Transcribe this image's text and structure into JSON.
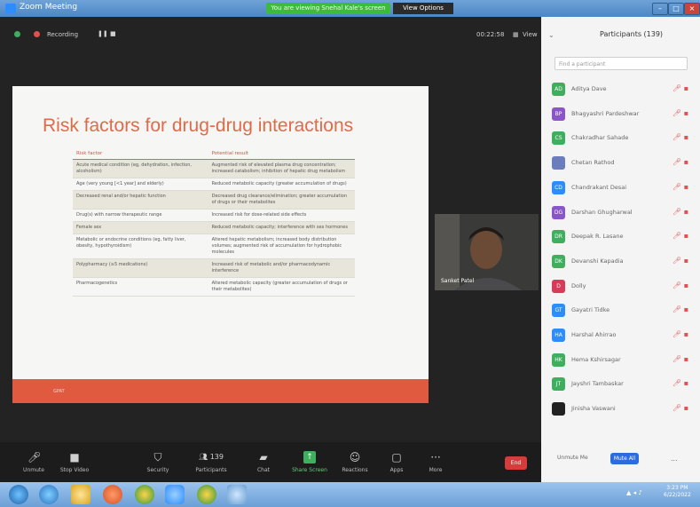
{
  "window": {
    "title": "Zoom Meeting",
    "share_banner": "You are viewing Snehal Kale's screen",
    "view_options": "View Options"
  },
  "topbar": {
    "recording": "Recording",
    "timer": "00:22:58",
    "view": "View"
  },
  "slide": {
    "title": "Risk factors for drug-drug interactions",
    "columns": [
      "Risk factor",
      "Potential result"
    ],
    "rows": [
      [
        "Acute medical condition (eg, dehydration, infection, alcoholism)",
        "Augmented risk of elevated plasma drug concentration; increased catabolism; inhibition of hepatic drug metabolism"
      ],
      [
        "Age (very young [<1 year] and elderly)",
        "Reduced metabolic capacity (greater accumulation of drugs)"
      ],
      [
        "Decreased renal and/or hepatic function",
        "Decreased drug clearance/elimination; greater accumulation of drugs or their metabolites"
      ],
      [
        "Drug(s) with narrow therapeutic range",
        "Increased risk for dose-related side effects"
      ],
      [
        "Female sex",
        "Reduced metabolic capacity; interference with sex hormones"
      ],
      [
        "Metabolic or endocrine conditions (eg, fatty liver, obesity, hypothyroidism)",
        "Altered hepatic metabolism; increased body distribution volumes; augmented risk of accumulation for hydrophobic molecules"
      ],
      [
        "Polypharmacy (≥5 medications)",
        "Increased risk of metabolic and/or pharmacodynamic interference"
      ],
      [
        "Pharmacogenetics",
        "Altered metabolic capacity (greater accumulation of drugs or their metabolites)"
      ]
    ],
    "footer": "GPAT"
  },
  "camera": {
    "name": "Sanket Patel"
  },
  "toolbar": {
    "unmute": "Unmute",
    "stop_video": "Stop Video",
    "security": "Security",
    "participants": "Participants",
    "participants_count": "139",
    "chat": "Chat",
    "share_screen": "Share Screen",
    "reactions": "Reactions",
    "apps": "Apps",
    "more": "More",
    "end": "End"
  },
  "panel": {
    "title": "Participants (139)",
    "search_placeholder": "Find a participant",
    "participants": [
      {
        "initials": "AD",
        "name": "Aditya Dave",
        "color": "#3fae5e"
      },
      {
        "initials": "BP",
        "name": "Bhagyashri Pardeshwar",
        "color": "#8a55c9"
      },
      {
        "initials": "CS",
        "name": "Chakradhar Sahade",
        "color": "#3fae5e"
      },
      {
        "initials": "",
        "name": "Chetan Rathod",
        "color": "#6a7dbd"
      },
      {
        "initials": "CD",
        "name": "Chandrakant Desai",
        "color": "#2d8cff"
      },
      {
        "initials": "DG",
        "name": "Darshan Ghugharwal",
        "color": "#8a55c9"
      },
      {
        "initials": "DR",
        "name": "Deepak R. Lasane",
        "color": "#3fae5e"
      },
      {
        "initials": "DK",
        "name": "Devanshi Kapadia",
        "color": "#3fae5e"
      },
      {
        "initials": "D",
        "name": "Dolly",
        "color": "#d83b5a"
      },
      {
        "initials": "GT",
        "name": "Gayatri Tidke",
        "color": "#2d8cff"
      },
      {
        "initials": "HA",
        "name": "Harshal Ahirrao",
        "color": "#2d8cff"
      },
      {
        "initials": "HK",
        "name": "Hema Kshirsagar",
        "color": "#3fae5e"
      },
      {
        "initials": "JT",
        "name": "Jayshri Tambaskar",
        "color": "#3fae5e"
      },
      {
        "initials": "",
        "name": "Jinisha Vaswani",
        "color": "#222222"
      }
    ],
    "unmute_me": "Unmute Me",
    "mute_all": "Mute All",
    "more": "..."
  },
  "taskbar": {
    "time": "3:23 PM",
    "date": "6/22/2022"
  }
}
